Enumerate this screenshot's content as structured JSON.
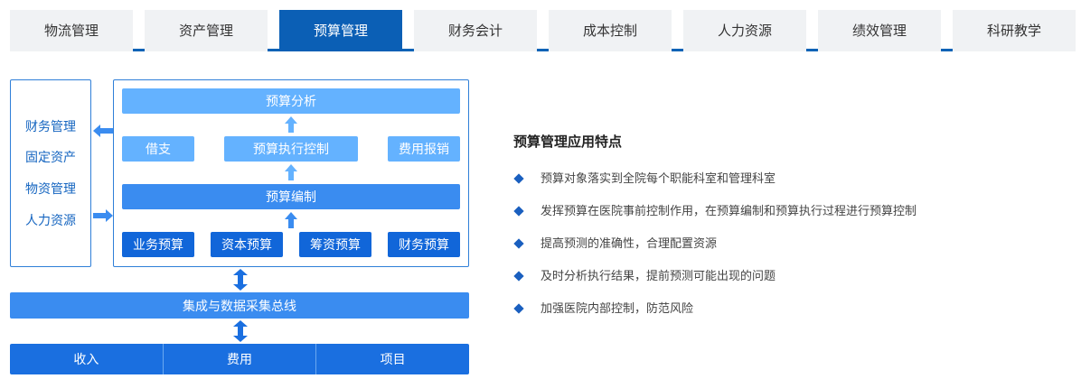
{
  "tabs": [
    {
      "label": "物流管理",
      "active": false
    },
    {
      "label": "资产管理",
      "active": false
    },
    {
      "label": "预算管理",
      "active": true
    },
    {
      "label": "财务会计",
      "active": false
    },
    {
      "label": "成本控制",
      "active": false
    },
    {
      "label": "人力资源",
      "active": false
    },
    {
      "label": "绩效管理",
      "active": false
    },
    {
      "label": "科研教学",
      "active": false
    }
  ],
  "diagram": {
    "side_items": [
      "财务管理",
      "固定资产",
      "物资管理",
      "人力资源"
    ],
    "analysis": "预算分析",
    "borrow": "借支",
    "execution_control": "预算执行控制",
    "expense_report": "费用报销",
    "compile": "预算编制",
    "budgets": [
      "业务预算",
      "资本预算",
      "筹资预算",
      "财务预算"
    ],
    "bus": "集成与数据采集总线",
    "bottom": [
      "收入",
      "费用",
      "项目"
    ]
  },
  "features": {
    "title": "预算管理应用特点",
    "items": [
      "预算对象落实到全院每个职能科室和管理科室",
      "发挥预算在医院事前控制作用，在预算编制和预算执行过程进行预算控制",
      "提高预测的准确性，合理配置资源",
      "及时分析执行结果，提前预测可能出现的问题",
      "加强医院内部控制，防范风险"
    ]
  },
  "colors": {
    "accent": "#0b5fb5",
    "light_box": "#64b2ff",
    "mid_box": "#3a8cf0",
    "dark_box": "#1166d9"
  }
}
